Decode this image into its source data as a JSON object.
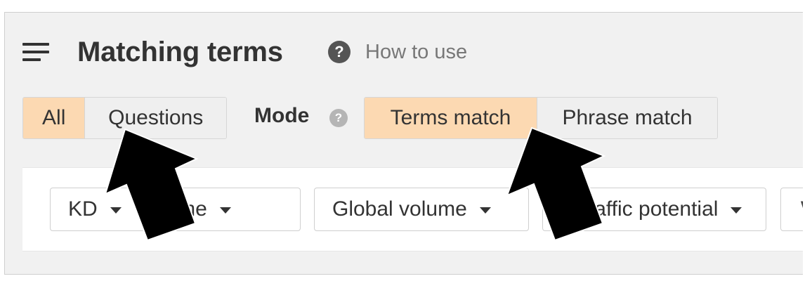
{
  "header": {
    "title": "Matching terms",
    "help_icon": "question-circle-icon",
    "help_text": "How to use"
  },
  "tabs": {
    "items": [
      {
        "label": "All",
        "active": true
      },
      {
        "label": "Questions",
        "active": false
      }
    ]
  },
  "mode": {
    "label": "Mode",
    "help_icon": "?",
    "options": [
      {
        "label": "Terms match",
        "active": true
      },
      {
        "label": "Phrase match",
        "active": false
      }
    ]
  },
  "filters": [
    {
      "label": "KD"
    },
    {
      "label": "Volume"
    },
    {
      "label": "Global volume"
    },
    {
      "label": "Traffic potential"
    },
    {
      "label": "W"
    }
  ],
  "colors": {
    "active_bg": "#fcd9b2",
    "inactive_bg": "#efefef",
    "panel_bg": "#f1f1f1",
    "text": "#333333",
    "annotation_arrow": "#000000"
  }
}
